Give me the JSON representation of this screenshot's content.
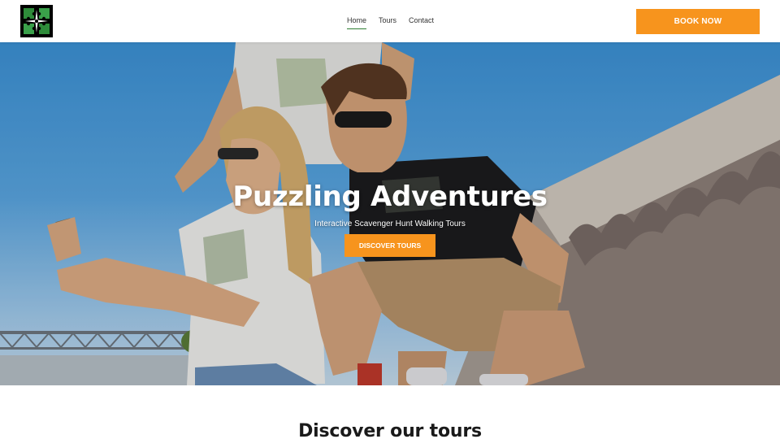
{
  "header": {
    "logo_alt": "Puzzling Adventures logo",
    "nav": [
      {
        "label": "Home",
        "active": true
      },
      {
        "label": "Tours",
        "active": false
      },
      {
        "label": "Contact",
        "active": false
      }
    ],
    "book_label": "BOOK NOW"
  },
  "hero": {
    "title": "Puzzling Adventures",
    "subtitle": "Interactive Scavenger Hunt Walking Tours",
    "cta_label": "DISCOVER TOURS"
  },
  "section": {
    "title": "Discover our tours"
  },
  "colors": {
    "accent": "#f7941d",
    "nav_active_underline": "#2e7d32",
    "logo_green": "#2e8b3a"
  },
  "icons": {
    "logo": "puzzle-compass-logo"
  }
}
